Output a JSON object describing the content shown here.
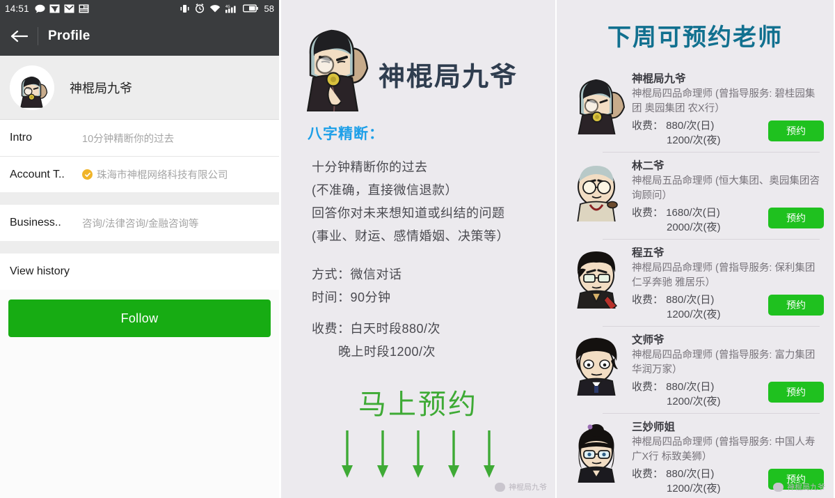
{
  "left": {
    "statusbar": {
      "time": "14:51",
      "battery_percent": "58",
      "icons_left": [
        "chat-bubble-icon",
        "mail-sent-icon",
        "mail-icon",
        "news-icon"
      ],
      "icons_right": [
        "vibrate-icon",
        "alarm-icon",
        "wifi-icon",
        "signal-4g-icon",
        "battery-icon"
      ]
    },
    "appbar": {
      "back": "back-arrow-icon",
      "title": "Profile"
    },
    "profile": {
      "name": "神棍局九爷",
      "avatar": "cartoon-avatar"
    },
    "rows": [
      {
        "label": "Intro",
        "value": "10分钟精断你的过去",
        "verified": false
      },
      {
        "label": "Account T..",
        "value": "珠海市神棍网络科技有限公司",
        "verified": true
      },
      {
        "label": "Business..",
        "value": "咨询/法律咨询/金融咨询等",
        "verified": false
      }
    ],
    "history_label": "View history",
    "follow_label": "Follow",
    "colors": {
      "follow_green": "#17ac13",
      "verified_amber": "#f0b429",
      "appbar": "#3a3c3e"
    }
  },
  "middle": {
    "title": "神棍局九爷",
    "heading": "八字精断：",
    "lines": [
      "十分钟精断你的过去",
      "(不准确，直接微信退款）",
      "回答你对未来想知道或纠结的问题",
      "(事业、财运、感情婚姻、决策等）"
    ],
    "details": [
      {
        "text": "方式：微信对话",
        "indent": false
      },
      {
        "text": "时间：90分钟",
        "indent": false
      },
      {
        "text": "收费：白天时段880/次",
        "indent": false
      },
      {
        "text": "晚上时段1200/次",
        "indent": true
      }
    ],
    "cta": "马上预约",
    "arrow_count": 5,
    "watermark": "神棍局九爷",
    "colors": {
      "heading_blue": "#1c9fe8",
      "cta_green": "#3eaa35",
      "title_dark": "#2f3d4f"
    }
  },
  "right": {
    "title": "下周可预约老师",
    "watermark": "神棍局九爷",
    "book_label": "预约",
    "colors": {
      "title_teal": "#11708f",
      "book_green": "#1fc11f"
    },
    "teachers": [
      {
        "name": "神棍局九爷",
        "desc": "神棍局四品命理师 (曾指导服务: 碧桂园集团 奥园集团 农X行）",
        "price_day": "收费： 880/次(日)",
        "price_night": "1200/次(夜)",
        "avatar": "avatar-jiuye"
      },
      {
        "name": "林二爷",
        "desc": "神棍局五品命理师 (恒大集团、奥园集团咨询顾问）",
        "price_day": "收费： 1680/次(日)",
        "price_night": "2000/次(夜)",
        "avatar": "avatar-linerye"
      },
      {
        "name": "程五爷",
        "desc": "神棍局四品命理师 (曾指导服务: 保利集团 仁孚奔驰 雅居乐）",
        "price_day": "收费： 880/次(日)",
        "price_night": "1200/次(夜)",
        "avatar": "avatar-chengwuye"
      },
      {
        "name": "文师爷",
        "desc": "神棍局四品命理师 (曾指导服务: 富力集团 华润万家）",
        "price_day": "收费： 880/次(日)",
        "price_night": "1200/次(夜)",
        "avatar": "avatar-wenshiye"
      },
      {
        "name": "三妙师姐",
        "desc": "神棍局四品命理师 (曾指导服务: 中国人寿 广X行 标致美狮）",
        "price_day": "收费： 880/次(日)",
        "price_night": "1200/次(夜)",
        "avatar": "avatar-sanmiaoshijie"
      }
    ]
  }
}
